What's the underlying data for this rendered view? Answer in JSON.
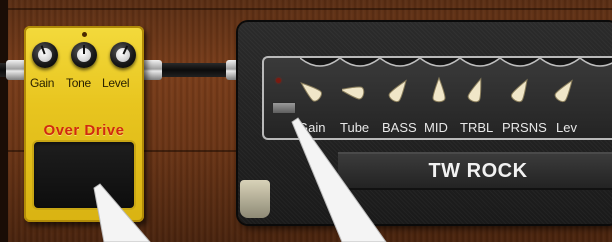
{
  "pedal": {
    "knob_labels": [
      "Gain",
      "Tone",
      "Level"
    ],
    "title": "Over Drive",
    "color": "#e8c51f",
    "title_color": "#d12a10"
  },
  "amp": {
    "knob_labels": [
      "Gain",
      "Tube",
      "BASS",
      "MID",
      "TRBL",
      "PRSNS",
      "Lev"
    ],
    "brand": "TW ROCK"
  }
}
